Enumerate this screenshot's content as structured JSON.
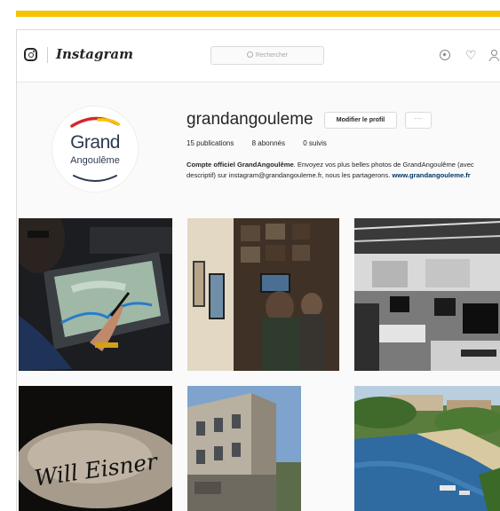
{
  "app": {
    "brand": "Instagram",
    "accent_color": "#f5c400"
  },
  "search": {
    "placeholder": "Rechercher",
    "icon": "search-icon"
  },
  "nav_icons": [
    "compass-icon",
    "heart-icon",
    "user-icon"
  ],
  "profile": {
    "username": "grandangouleme",
    "edit_button": "Modifier le profil",
    "more_button": "···",
    "stats": {
      "posts": "15 publications",
      "followers": "8 abonnés",
      "following": "0 suivis"
    },
    "bio": {
      "name": "Compte officiel GrandAngoulême",
      "text": ". Envoyez vos plus belles photos de GrandAngoulême (avec descriptif) sur instagram@grandangouleme.fr, nous les partagerons.",
      "link": "www.grandangouleme.fr"
    },
    "logo": {
      "line1": "Grand",
      "line2": "Angoulême",
      "colors": [
        "#d7262e",
        "#f5c400",
        "#2c3b52"
      ]
    }
  },
  "posts": [
    {
      "subject": "digital artist drawing on a tablet"
    },
    {
      "subject": "office wall with framed pictures"
    },
    {
      "subject": "open-plan office with computers (black and white)"
    },
    {
      "subject": "Will Eisner signature",
      "text": "Will Eisner"
    },
    {
      "subject": "old stone building facade"
    },
    {
      "subject": "river with boats and town"
    }
  ]
}
